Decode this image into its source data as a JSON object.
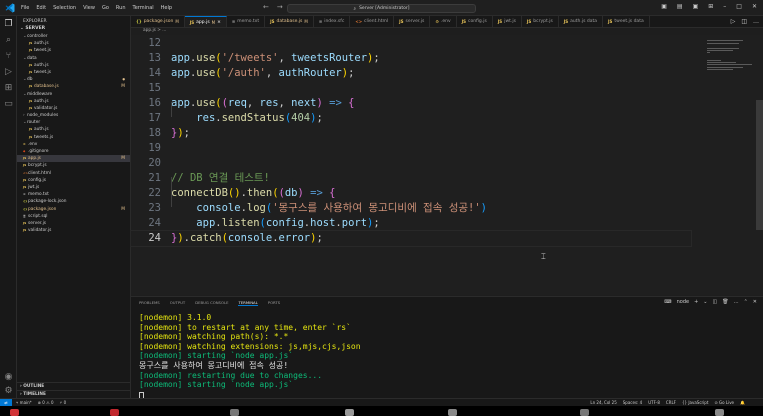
{
  "titlebar": {
    "menu": [
      "File",
      "Edit",
      "Selection",
      "View",
      "Go",
      "Run",
      "Terminal",
      "Help"
    ],
    "search": "Server [Administrator]"
  },
  "sidebar": {
    "title": "EXPLORER",
    "root": "SERVER",
    "items": [
      {
        "label": "controller",
        "depth": 1,
        "type": "folder",
        "open": true
      },
      {
        "label": "auth.js",
        "depth": 2,
        "type": "js"
      },
      {
        "label": "tweet.js",
        "depth": 2,
        "type": "js"
      },
      {
        "label": "data",
        "depth": 1,
        "type": "folder",
        "open": true
      },
      {
        "label": "auth.js",
        "depth": 2,
        "type": "js"
      },
      {
        "label": "tweet.js",
        "depth": 2,
        "type": "js"
      },
      {
        "label": "db",
        "depth": 1,
        "type": "folder",
        "open": true,
        "dot": true
      },
      {
        "label": "database.js",
        "depth": 2,
        "type": "js",
        "badge": "M",
        "modified": true
      },
      {
        "label": "middleware",
        "depth": 1,
        "type": "folder",
        "open": true
      },
      {
        "label": "auth.js",
        "depth": 2,
        "type": "js"
      },
      {
        "label": "validator.js",
        "depth": 2,
        "type": "js"
      },
      {
        "label": "node_modules",
        "depth": 1,
        "type": "folder",
        "open": false
      },
      {
        "label": "router",
        "depth": 1,
        "type": "folder",
        "open": true
      },
      {
        "label": "auth.js",
        "depth": 2,
        "type": "js"
      },
      {
        "label": "tweets.js",
        "depth": 2,
        "type": "js"
      },
      {
        "label": ".env",
        "depth": 1,
        "type": "env"
      },
      {
        "label": ".gitignore",
        "depth": 1,
        "type": "git"
      },
      {
        "label": "app.js",
        "depth": 1,
        "type": "js",
        "badge": "M",
        "modified": true,
        "active": true
      },
      {
        "label": "bcrypt.js",
        "depth": 1,
        "type": "js"
      },
      {
        "label": "client.html",
        "depth": 1,
        "type": "html"
      },
      {
        "label": "config.js",
        "depth": 1,
        "type": "js"
      },
      {
        "label": "jwt.js",
        "depth": 1,
        "type": "js"
      },
      {
        "label": "memo.txt",
        "depth": 1,
        "type": "txt"
      },
      {
        "label": "package-lock.json",
        "depth": 1,
        "type": "json"
      },
      {
        "label": "package.json",
        "depth": 1,
        "type": "json",
        "badge": "M",
        "modified": true
      },
      {
        "label": "script.sql",
        "depth": 1,
        "type": "sql"
      },
      {
        "label": "server.js",
        "depth": 1,
        "type": "js"
      },
      {
        "label": "validator.js",
        "depth": 1,
        "type": "js"
      }
    ],
    "outline": "OUTLINE",
    "timeline": "TIMELINE"
  },
  "tabs": [
    {
      "label": "package.json",
      "icon": "{}",
      "badge": "M",
      "modified": true
    },
    {
      "label": "app.js",
      "icon": "JS",
      "badge": "M",
      "active": true
    },
    {
      "label": "memo.txt",
      "icon": "≡"
    },
    {
      "label": "database.js",
      "icon": "JS",
      "badge": "M",
      "modified": true
    },
    {
      "label": "index.sfc",
      "icon": "≡"
    },
    {
      "label": "client.html",
      "icon": "<>"
    },
    {
      "label": "server.js",
      "icon": "JS"
    },
    {
      "label": ".env",
      "icon": "⚙"
    },
    {
      "label": "config.js",
      "icon": "JS"
    },
    {
      "label": "jwt.js",
      "icon": "JS"
    },
    {
      "label": "bcrypt.js",
      "icon": "JS"
    },
    {
      "label": "auth.js  data",
      "icon": "JS"
    },
    {
      "label": "tweet.js  data",
      "icon": "JS"
    }
  ],
  "breadcrumb": "app.js > ...",
  "editor": {
    "lines": [
      {
        "n": "12",
        "tokens": []
      },
      {
        "n": "13",
        "tokens": [
          [
            "t-var",
            "app"
          ],
          [
            "",
            "."
          ],
          [
            "t-fn",
            "use"
          ],
          [
            "t-p1",
            "("
          ],
          [
            "t-str",
            "'/tweets'"
          ],
          [
            "",
            ", "
          ],
          [
            "t-var",
            "tweetsRouter"
          ],
          [
            "t-p1",
            ")"
          ],
          [
            "",
            ";"
          ]
        ]
      },
      {
        "n": "14",
        "tokens": [
          [
            "t-var",
            "app"
          ],
          [
            "",
            "."
          ],
          [
            "t-fn",
            "use"
          ],
          [
            "t-p1",
            "("
          ],
          [
            "t-str",
            "'/auth'"
          ],
          [
            "",
            ", "
          ],
          [
            "t-var",
            "authRouter"
          ],
          [
            "t-p1",
            ")"
          ],
          [
            "",
            ";"
          ]
        ]
      },
      {
        "n": "15",
        "tokens": []
      },
      {
        "n": "16",
        "tokens": [
          [
            "t-var",
            "app"
          ],
          [
            "",
            "."
          ],
          [
            "t-fn",
            "use"
          ],
          [
            "t-p1",
            "("
          ],
          [
            "t-p2",
            "("
          ],
          [
            "t-var",
            "req"
          ],
          [
            "",
            ", "
          ],
          [
            "t-var",
            "res"
          ],
          [
            "",
            ", "
          ],
          [
            "t-var",
            "next"
          ],
          [
            "t-p2",
            ")"
          ],
          [
            "t-kw",
            " =>"
          ],
          [
            "",
            " "
          ],
          [
            "t-p2",
            "{"
          ]
        ]
      },
      {
        "n": "17",
        "tokens": [
          [
            "",
            "    "
          ],
          [
            "t-var",
            "res"
          ],
          [
            "",
            "."
          ],
          [
            "t-fn",
            "sendStatus"
          ],
          [
            "t-p3",
            "("
          ],
          [
            "t-num",
            "404"
          ],
          [
            "t-p3",
            ")"
          ],
          [
            "",
            ";"
          ]
        ]
      },
      {
        "n": "18",
        "tokens": [
          [
            "t-p2",
            "}"
          ],
          [
            "t-p1",
            ")"
          ],
          [
            "",
            ";"
          ]
        ]
      },
      {
        "n": "19",
        "tokens": []
      },
      {
        "n": "20",
        "tokens": []
      },
      {
        "n": "21",
        "tokens": [
          [
            "t-com",
            "// DB 연결 테스트!"
          ]
        ]
      },
      {
        "n": "22",
        "tokens": [
          [
            "t-fn",
            "connectDB"
          ],
          [
            "t-p1",
            "()"
          ],
          [
            "",
            "."
          ],
          [
            "t-fn",
            "then"
          ],
          [
            "t-p1",
            "("
          ],
          [
            "t-p2",
            "("
          ],
          [
            "t-var",
            "db"
          ],
          [
            "t-p2",
            ")"
          ],
          [
            "t-kw",
            " =>"
          ],
          [
            "",
            " "
          ],
          [
            "t-p2",
            "{"
          ]
        ]
      },
      {
        "n": "23",
        "tokens": [
          [
            "",
            "    "
          ],
          [
            "t-var",
            "console"
          ],
          [
            "",
            "."
          ],
          [
            "t-fn",
            "log"
          ],
          [
            "t-p3",
            "("
          ],
          [
            "t-str",
            "'몽구스를 사용하여 몽고디비에 접속 성공!'"
          ],
          [
            "t-p3",
            ")"
          ]
        ]
      },
      {
        "n": "24",
        "tokens": [
          [
            "",
            "    "
          ],
          [
            "t-var",
            "app"
          ],
          [
            "",
            "."
          ],
          [
            "t-fn",
            "listen"
          ],
          [
            "t-p3",
            "("
          ],
          [
            "t-var",
            "config"
          ],
          [
            "",
            "."
          ],
          [
            "t-var",
            "host"
          ],
          [
            "",
            "."
          ],
          [
            "t-var",
            "port"
          ],
          [
            "t-p3",
            ")"
          ],
          [
            "",
            ";"
          ]
        ]
      },
      {
        "n": "24",
        "tokens": [
          [
            "t-p2",
            "}"
          ],
          [
            "t-p1",
            ")"
          ],
          [
            "",
            "."
          ],
          [
            "t-fn",
            "catch"
          ],
          [
            "t-p1",
            "("
          ],
          [
            "t-var",
            "console"
          ],
          [
            "",
            "."
          ],
          [
            "t-var",
            "error"
          ],
          [
            "t-p1",
            ")"
          ],
          [
            "",
            ";"
          ]
        ],
        "current": true
      }
    ]
  },
  "panel": {
    "tabs": [
      "PROBLEMS",
      "OUTPUT",
      "DEBUG CONSOLE",
      "TERMINAL",
      "PORTS"
    ],
    "active_tab": "TERMINAL",
    "shell": "node",
    "terminal": [
      {
        "cls": "t-yel",
        "text": "[nodemon] 3.1.0"
      },
      {
        "cls": "t-yel",
        "text": "[nodemon] to restart at any time, enter `rs`"
      },
      {
        "cls": "t-yel",
        "text": "[nodemon] watching path(s): *.*"
      },
      {
        "cls": "t-yel",
        "text": "[nodemon] watching extensions: js,mjs,cjs,json"
      },
      {
        "cls": "t-grn",
        "text": "[nodemon] starting `node app.js`"
      },
      {
        "cls": "t-wht",
        "text": "몽구스를 사용하여 몽고디비에 접속 성공!"
      },
      {
        "cls": "t-grn",
        "text": "[nodemon] restarting due to changes..."
      },
      {
        "cls": "t-grn",
        "text": "[nodemon] starting `node app.js`"
      }
    ]
  },
  "statusbar": {
    "branch": "main*",
    "problems": "⊗ 0 ⚠ 0",
    "ports": "⚡ 0",
    "position": "Ln 24, Col 25",
    "spaces": "Spaces: 4",
    "encoding": "UTF-8",
    "eol": "CRLF",
    "language": "{} JavaScript",
    "golive": "⊙ Go Live"
  }
}
